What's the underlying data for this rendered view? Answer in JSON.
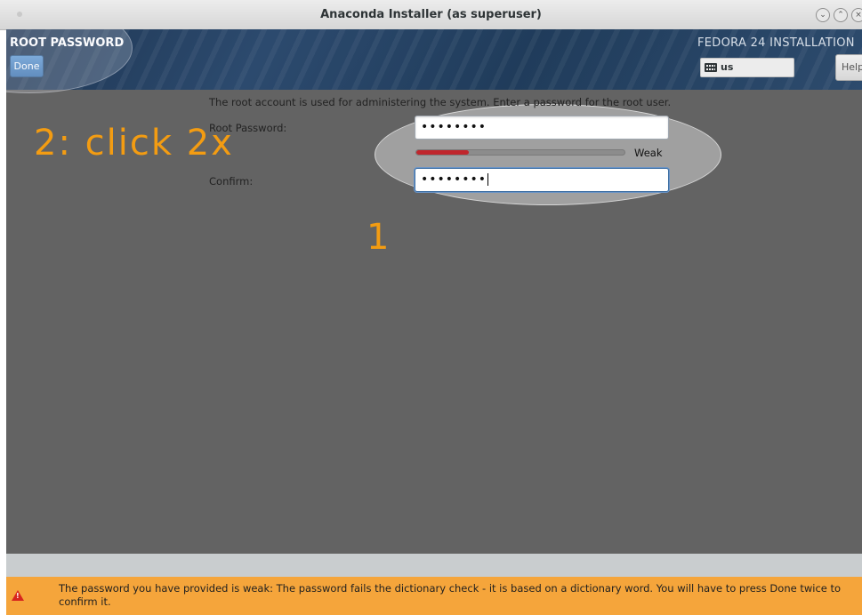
{
  "window": {
    "title": "Anaconda Installer (as superuser)",
    "controls": [
      "minimize-icon",
      "maximize-icon",
      "close-icon"
    ]
  },
  "header": {
    "spoke_title": "ROOT PASSWORD",
    "done_label": "Done",
    "product_title": "FEDORA 24 INSTALLATION",
    "keyboard_layout": "us",
    "help_label": "Help!"
  },
  "form": {
    "intro": "The root account is used for administering the system.  Enter a password for the root user.",
    "root_password_label": "Root Password:",
    "root_password_value": "••••••••",
    "strength_label": "Weak",
    "strength_level": 0.25,
    "confirm_label": "Confirm:",
    "confirm_value": "••••••••"
  },
  "annotations": {
    "click_note": "2: click 2x",
    "step_one": "1"
  },
  "warning": {
    "message": "The password you have provided is weak: The password fails the dictionary check - it is based on a dictionary word. You will have to press Done twice to confirm it."
  },
  "colors": {
    "header_bg": "#203c5b",
    "content_bg": "#636363",
    "warning_bg": "#f5a53b",
    "annotation": "#f39c12",
    "strength_weak": "#c0262c"
  }
}
